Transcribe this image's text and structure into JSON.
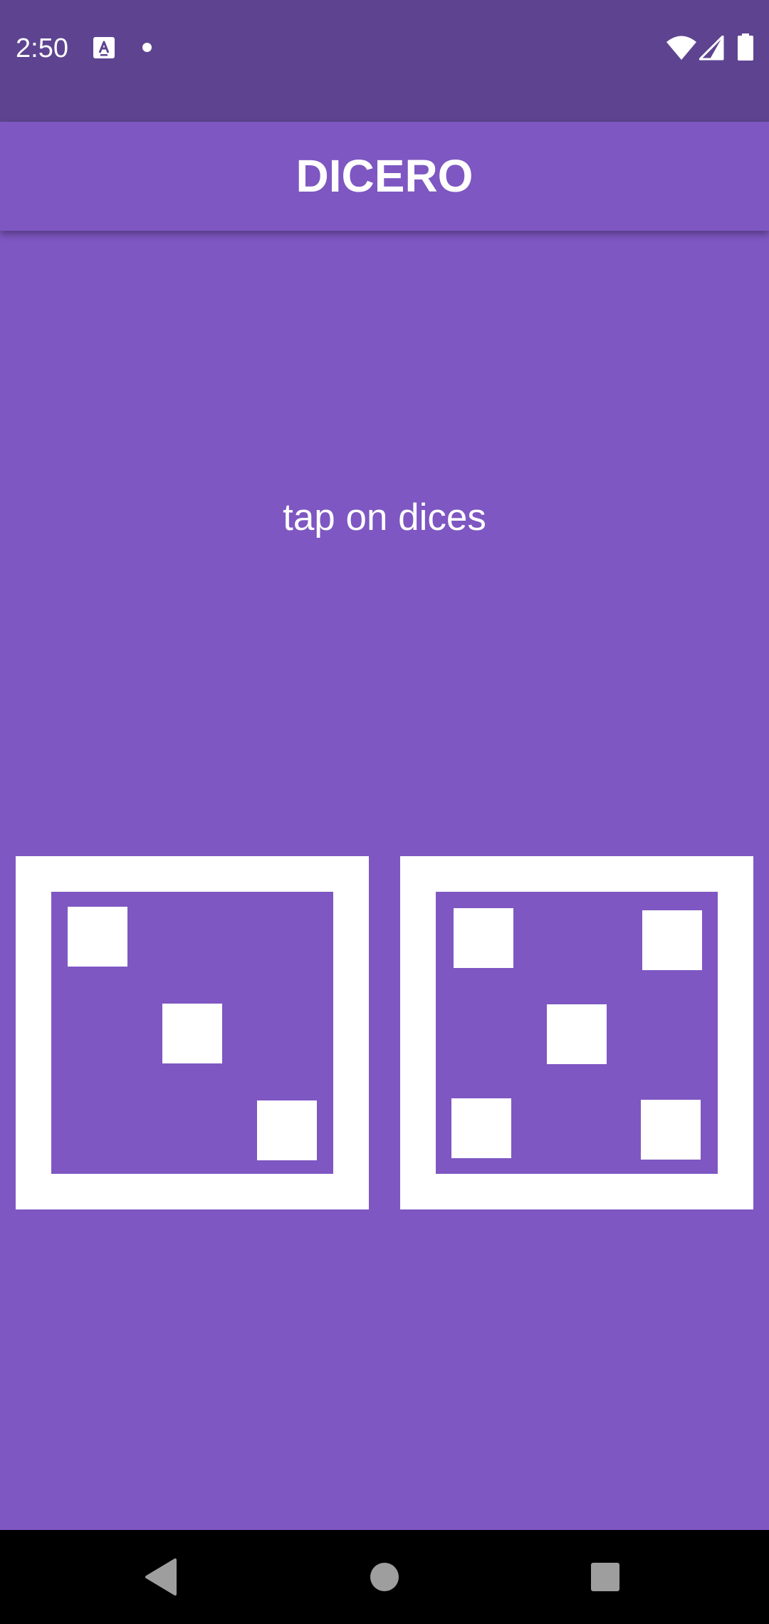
{
  "status_bar": {
    "time": "2:50",
    "icons": [
      "text-a-notification-icon",
      "notification-dot-icon",
      "wifi-icon",
      "cell-signal-icon",
      "battery-icon"
    ]
  },
  "app_bar": {
    "title": "DICERO"
  },
  "main": {
    "hint": "tap on dices",
    "dice": [
      {
        "value": 3
      },
      {
        "value": 5
      }
    ]
  },
  "navigation_bar": {
    "buttons": [
      "back-icon",
      "home-icon",
      "recents-icon"
    ]
  },
  "colors": {
    "status_bar": "#5e4490",
    "primary": "#7e57c2",
    "foreground": "#ffffff",
    "nav_bar": "#000000",
    "nav_icons": "#9e9e9e"
  }
}
